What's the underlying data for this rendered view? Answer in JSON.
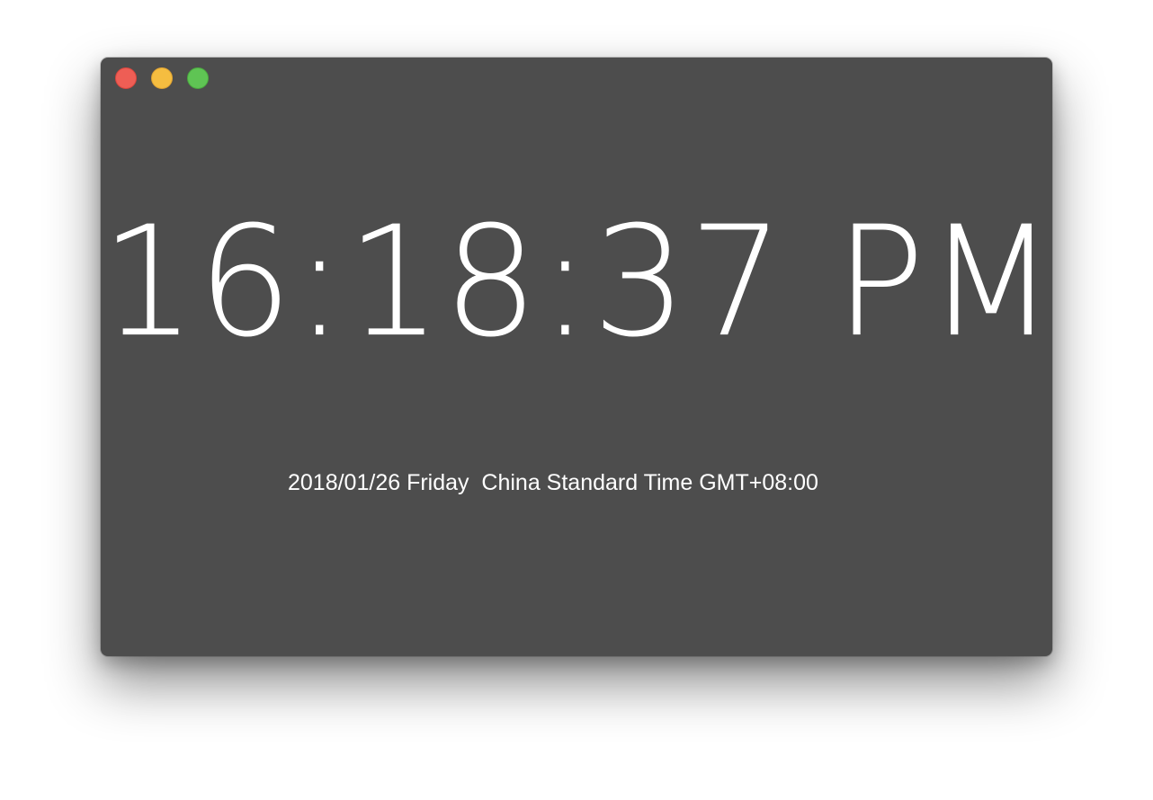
{
  "window": {
    "background_color": "#4d4d4d",
    "controls": {
      "close": {
        "icon": "close-dot",
        "color": "#ee5e55"
      },
      "minimize": {
        "icon": "minimize-dot",
        "color": "#f5bd40"
      },
      "zoom": {
        "icon": "zoom-dot",
        "color": "#5fc454"
      }
    }
  },
  "clock": {
    "time": "16:18:37  PM",
    "date_line": "2018/01/26 Friday  China Standard Time GMT+08:00"
  }
}
